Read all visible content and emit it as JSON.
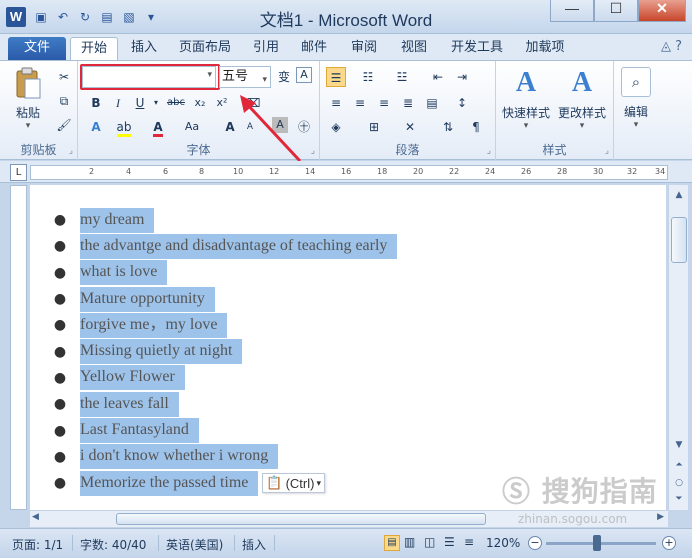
{
  "window": {
    "app_icon": "W",
    "title": "文档1 - Microsoft Word",
    "min": "—",
    "max": "☐",
    "close": "✕"
  },
  "qat": [
    "save-icon",
    "undo-icon",
    "redo-icon",
    "open-icon",
    "print-preview-icon",
    "customize-icon"
  ],
  "tabs": [
    "文件",
    "开始",
    "插入",
    "页面布局",
    "引用",
    "邮件",
    "审阅",
    "视图",
    "开发工具",
    "加载项"
  ],
  "active_tab": "开始",
  "help_glyph": "◬ ?",
  "ribbon": {
    "clipboard": {
      "paste_label": "粘贴",
      "group_label": "剪贴板"
    },
    "font": {
      "font_name": "",
      "font_size": "五号",
      "group_label": "字体"
    },
    "paragraph": {
      "group_label": "段落"
    },
    "styles": {
      "quick_styles": "快速样式",
      "change_styles": "更改样式",
      "group_label": "样式"
    },
    "editing": {
      "label": "编辑"
    }
  },
  "ruler": {
    "corner": "L",
    "marks": [
      "2",
      "4",
      "6",
      "8",
      "10",
      "12",
      "14",
      "16",
      "18",
      "20",
      "22",
      "24",
      "26",
      "28",
      "30",
      "32",
      "34"
    ]
  },
  "document": {
    "items": [
      "my dream",
      "the advantge and disadvantage of teaching early",
      "what is love",
      "Mature opportunity",
      "forgive me，my love",
      "Missing quietly at night",
      "Yellow Flower",
      "the leaves fall",
      "Last Fantasyland",
      "i don't know whether i wrong",
      "Memorize the passed time"
    ],
    "paste_tag": "(Ctrl)"
  },
  "status": {
    "page": "页面: 1/1",
    "words": "字数: 40/40",
    "language": "英语(美国)",
    "mode": "插入",
    "zoom": "120%"
  },
  "watermark": {
    "text": "搜狗指南",
    "url": "zhinan.sogou.com"
  },
  "colors": {
    "selection": "#9ec3ea",
    "highlight_box": "#e0283a",
    "accent": "#2a5699"
  }
}
